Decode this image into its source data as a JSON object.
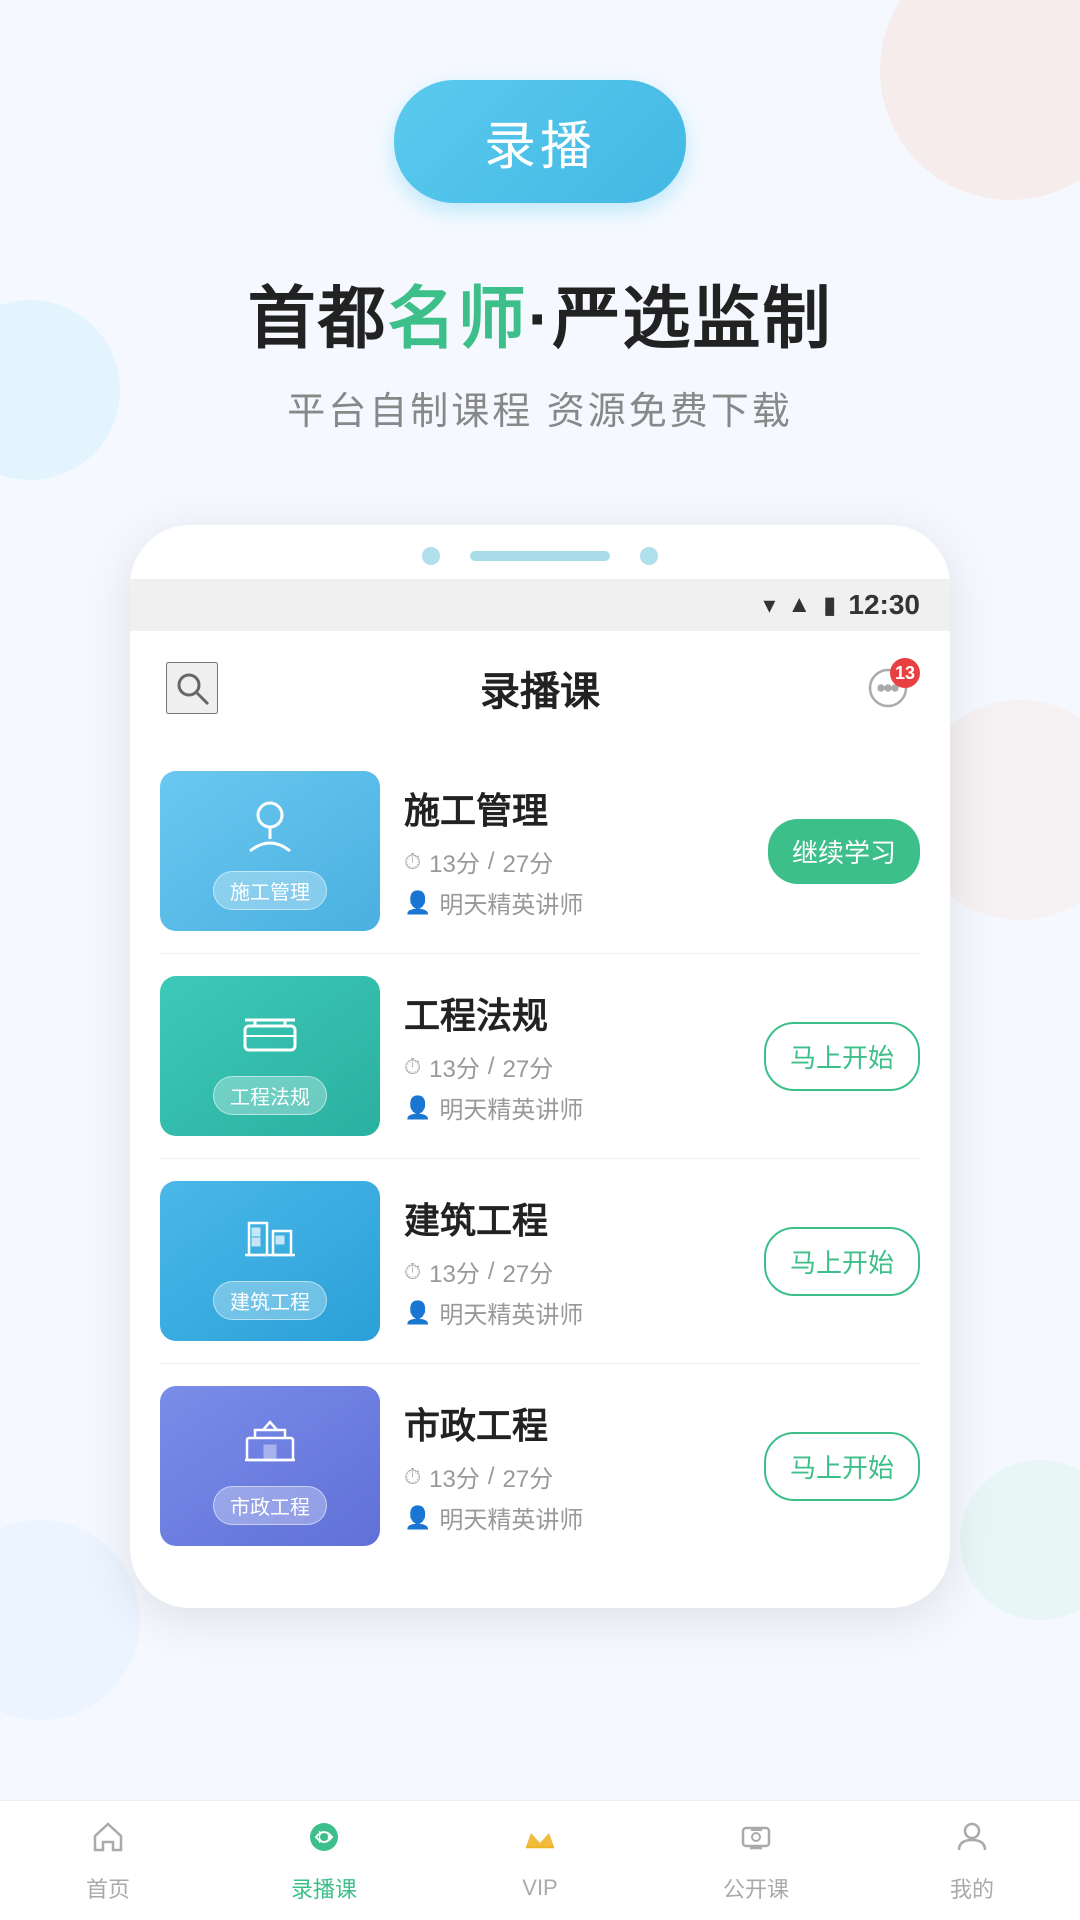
{
  "app": {
    "record_btn_label": "录播",
    "headline_part1": "首都",
    "headline_highlight": "名师",
    "headline_part2": "·严选监制",
    "subtitle": "平台自制课程  资源免费下载",
    "page_title": "录播课",
    "status_time": "12:30",
    "msg_badge": "13"
  },
  "courses": [
    {
      "id": 1,
      "name": "施工管理",
      "thumb_label": "施工管理",
      "thumb_color": "blue",
      "time_current": "13分",
      "time_total": "27分",
      "teacher": "明天精英讲师",
      "action_type": "continue",
      "action_label": "继续学习"
    },
    {
      "id": 2,
      "name": "工程法规",
      "thumb_label": "工程法规",
      "thumb_color": "teal",
      "time_current": "13分",
      "time_total": "27分",
      "teacher": "明天精英讲师",
      "action_type": "start",
      "action_label": "马上开始"
    },
    {
      "id": 3,
      "name": "建筑工程",
      "thumb_label": "建筑工程",
      "thumb_color": "cyan",
      "time_current": "13分",
      "time_total": "27分",
      "teacher": "明天精英讲师",
      "action_type": "start",
      "action_label": "马上开始"
    },
    {
      "id": 4,
      "name": "市政工程",
      "thumb_label": "市政工程",
      "thumb_color": "purple",
      "time_current": "13分",
      "time_total": "27分",
      "teacher": "明天精英讲师",
      "action_type": "start",
      "action_label": "马上开始"
    }
  ],
  "nav": {
    "items": [
      {
        "id": "home",
        "label": "首页",
        "active": false
      },
      {
        "id": "record",
        "label": "录播课",
        "active": true
      },
      {
        "id": "vip",
        "label": "VIP",
        "active": false
      },
      {
        "id": "live",
        "label": "公开课",
        "active": false
      },
      {
        "id": "mine",
        "label": "我的",
        "active": false
      }
    ]
  }
}
